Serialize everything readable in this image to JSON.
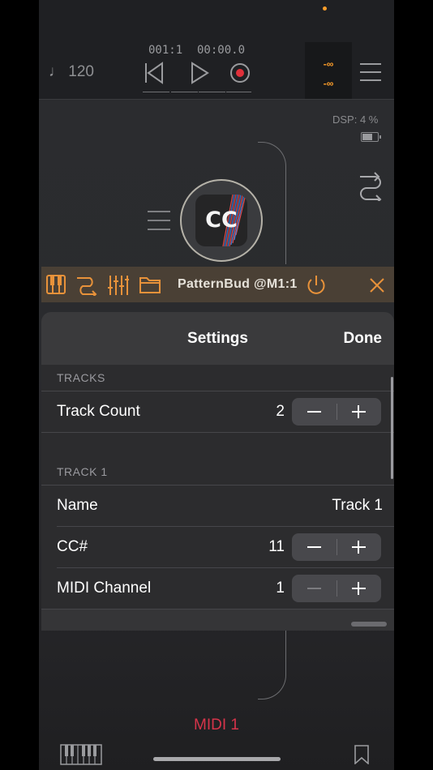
{
  "transport": {
    "tempo": "♩ 120",
    "position_bars": "001:1",
    "position_time": "00:00.0",
    "meter_top": "-∞",
    "meter_bottom": "-∞"
  },
  "status": {
    "dsp": "DSP:  4 %"
  },
  "node": {
    "label": "CC"
  },
  "plugin_bar": {
    "title": "PatternBud @M1:1",
    "accent_color": "#e8923a"
  },
  "settings": {
    "title": "Settings",
    "done_label": "Done",
    "sections": [
      {
        "header": "TRACKS",
        "rows": [
          {
            "label": "Track Count",
            "value": "2",
            "control": "stepper"
          }
        ]
      },
      {
        "header": "TRACK 1",
        "rows": [
          {
            "label": "Name",
            "value": "Track 1",
            "control": "text"
          },
          {
            "label": "CC#",
            "value": "11",
            "control": "stepper"
          },
          {
            "label": "MIDI Channel",
            "value": "1",
            "control": "stepper"
          }
        ]
      }
    ]
  },
  "bottom": {
    "midi_label": "MIDI 1",
    "midi_color": "#d6344a"
  },
  "icons": [
    "note-icon",
    "rewind-icon",
    "play-icon",
    "record-icon",
    "hamburger-menu-icon",
    "battery-icon",
    "routing-icon",
    "piano-keys-icon",
    "sliders-icon",
    "folder-icon",
    "power-icon",
    "close-icon",
    "bookmark-icon"
  ]
}
